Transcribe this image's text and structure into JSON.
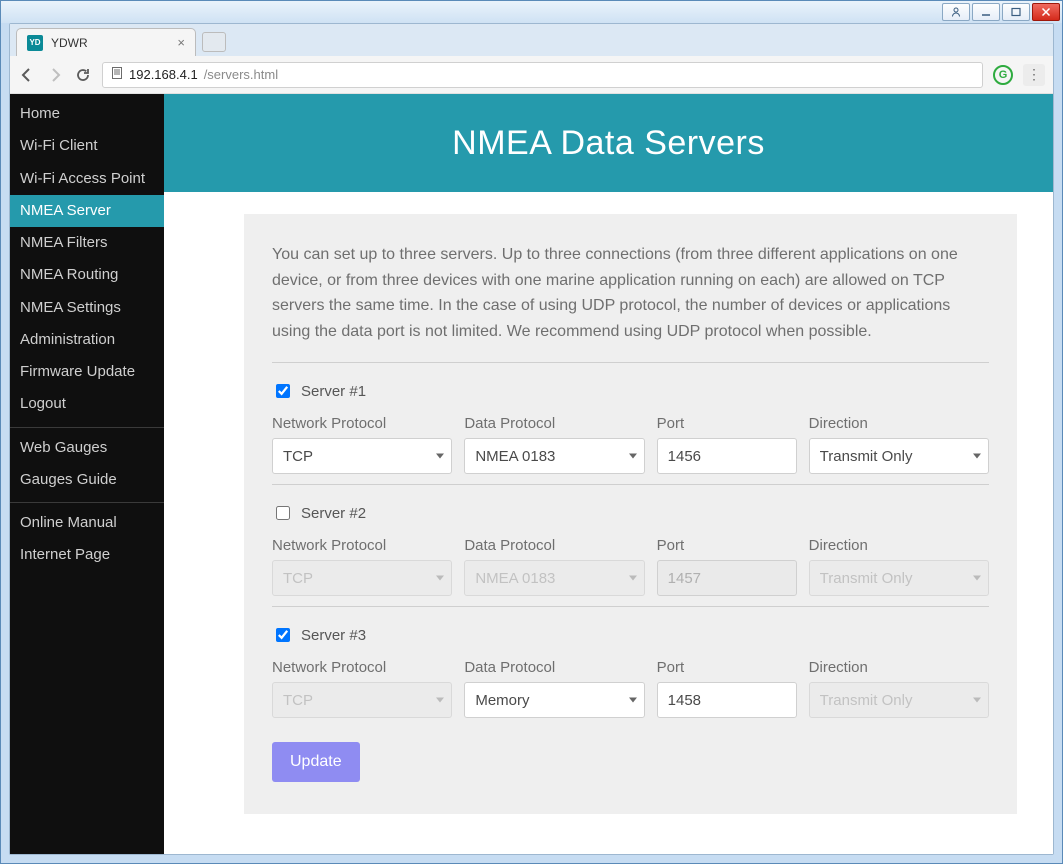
{
  "window": {
    "tab_title": "YDWR",
    "favicon_text": "YD",
    "url_host": "192.168.4.1",
    "url_path": "/servers.html"
  },
  "sidebar": {
    "groups": [
      {
        "items": [
          {
            "label": "Home",
            "active": false
          },
          {
            "label": "Wi-Fi Client",
            "active": false
          },
          {
            "label": "Wi-Fi Access Point",
            "active": false
          },
          {
            "label": "NMEA Server",
            "active": true
          },
          {
            "label": "NMEA Filters",
            "active": false
          },
          {
            "label": "NMEA Routing",
            "active": false
          },
          {
            "label": "NMEA Settings",
            "active": false
          },
          {
            "label": "Administration",
            "active": false
          },
          {
            "label": "Firmware Update",
            "active": false
          },
          {
            "label": "Logout",
            "active": false
          }
        ]
      },
      {
        "items": [
          {
            "label": "Web Gauges",
            "active": false
          },
          {
            "label": "Gauges Guide",
            "active": false
          }
        ]
      },
      {
        "items": [
          {
            "label": "Online Manual",
            "active": false
          },
          {
            "label": "Internet Page",
            "active": false
          }
        ]
      }
    ]
  },
  "page_title": "NMEA Data Servers",
  "intro_text": "You can set up to three servers. Up to three connections (from three different applications on one device, or from three devices with one marine application running on each) are allowed on TCP servers the same time. In the case of using UDP protocol, the number of devices or applications using the data port is not limited. We recommend using UDP protocol when possible.",
  "labels": {
    "network_protocol": "Network Protocol",
    "data_protocol": "Data Protocol",
    "port": "Port",
    "direction": "Direction"
  },
  "servers": [
    {
      "title": "Server #1",
      "enabled": true,
      "network_protocol": "TCP",
      "network_protocol_disabled": false,
      "data_protocol": "NMEA 0183",
      "data_protocol_disabled": false,
      "port": "1456",
      "port_disabled": false,
      "direction": "Transmit Only",
      "direction_disabled": false
    },
    {
      "title": "Server #2",
      "enabled": false,
      "network_protocol": "TCP",
      "network_protocol_disabled": true,
      "data_protocol": "NMEA 0183",
      "data_protocol_disabled": true,
      "port": "1457",
      "port_disabled": true,
      "direction": "Transmit Only",
      "direction_disabled": true
    },
    {
      "title": "Server #3",
      "enabled": true,
      "network_protocol": "TCP",
      "network_protocol_disabled": true,
      "data_protocol": "Memory",
      "data_protocol_disabled": false,
      "port": "1458",
      "port_disabled": false,
      "direction": "Transmit Only",
      "direction_disabled": true
    }
  ],
  "buttons": {
    "update": "Update"
  }
}
